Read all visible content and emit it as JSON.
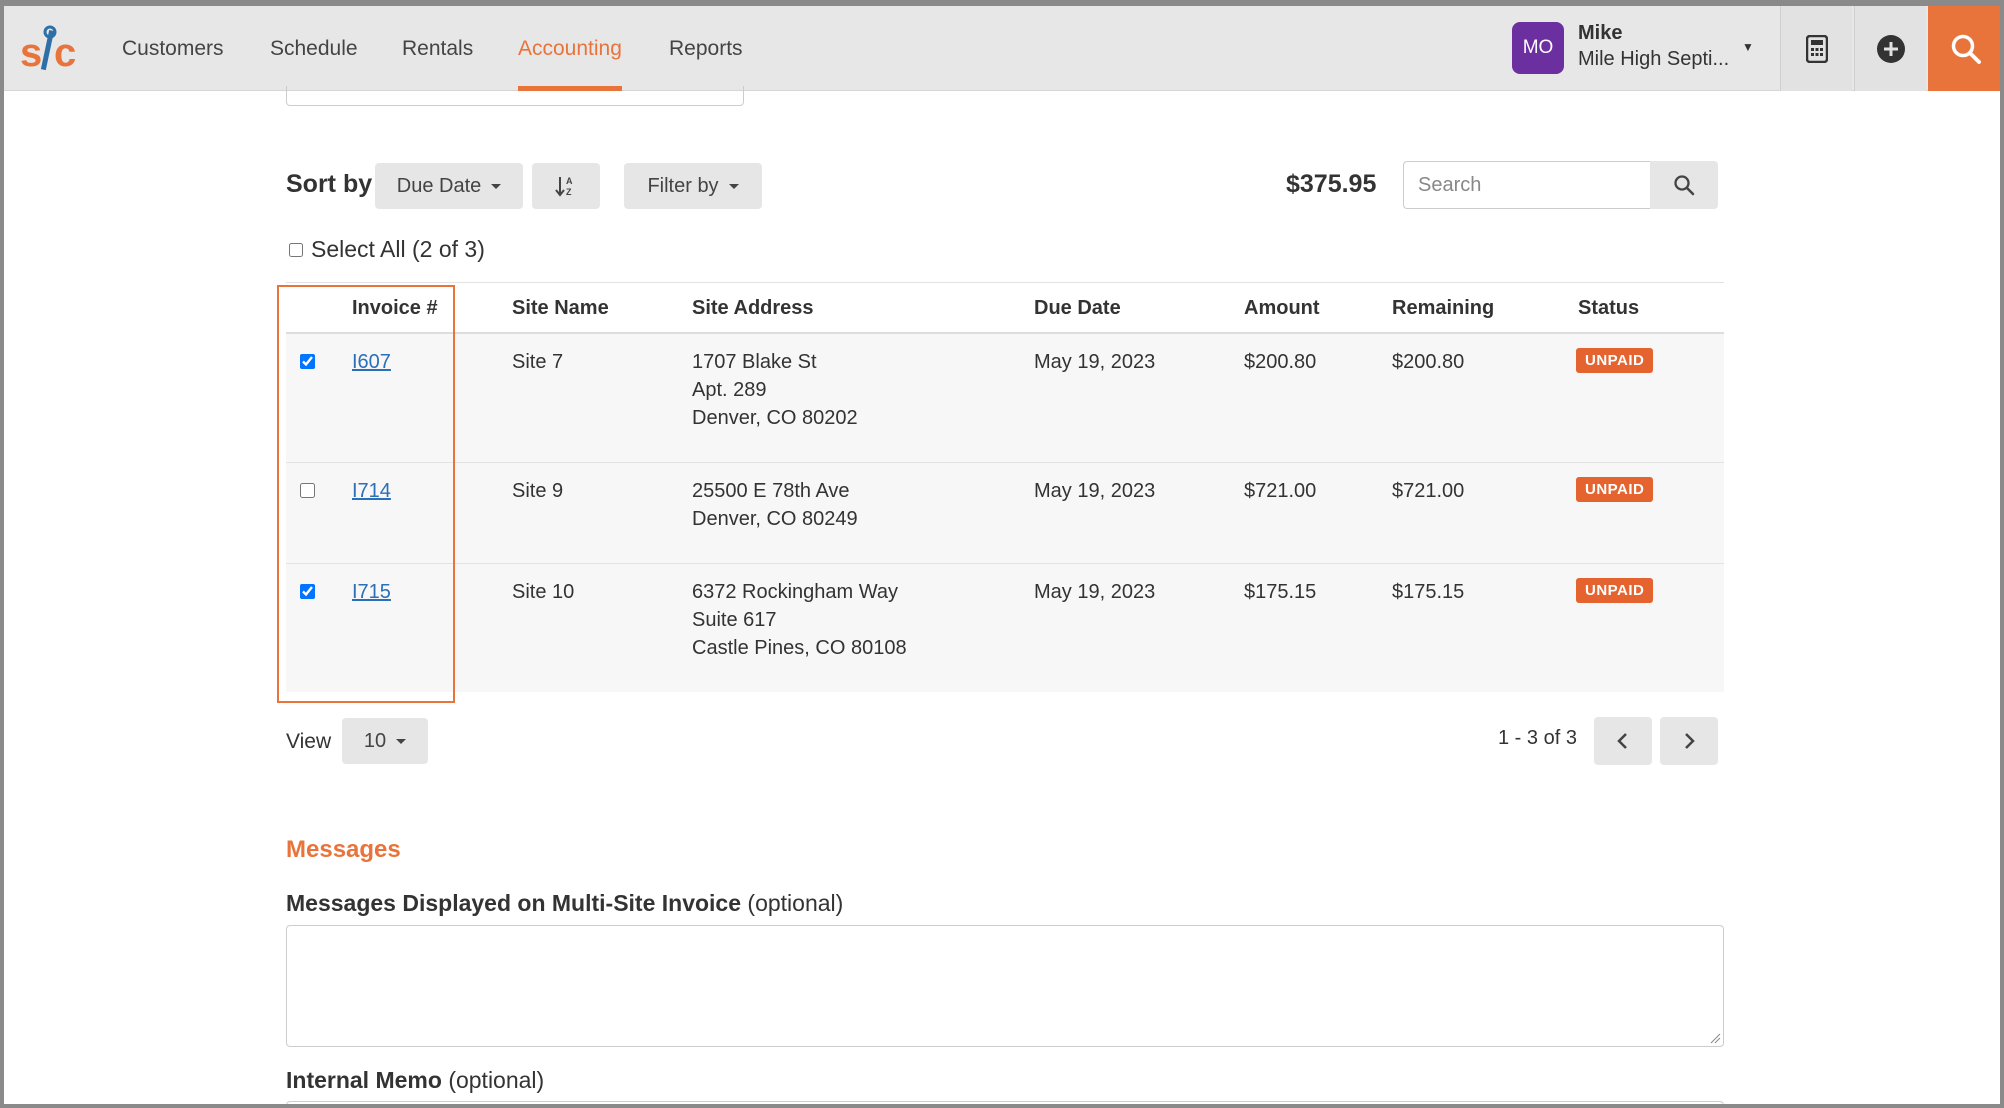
{
  "nav": {
    "items": [
      "Customers",
      "Schedule",
      "Rentals",
      "Accounting",
      "Reports"
    ],
    "active": "Accounting",
    "user": {
      "initials": "MO",
      "name": "Mike",
      "company": "Mile High Septi..."
    }
  },
  "toolbar": {
    "sort_label": "Sort by",
    "sort_value": "Due Date",
    "filter_label": "Filter by",
    "total": "$375.95",
    "search_placeholder": "Search"
  },
  "select_all": "Select All (2 of 3)",
  "table": {
    "headers": [
      "Invoice #",
      "Site Name",
      "Site Address",
      "Due Date",
      "Amount",
      "Remaining",
      "Status"
    ],
    "rows": [
      {
        "checked": true,
        "invoice": "I607",
        "site": "Site 7",
        "address": [
          "1707 Blake St",
          "Apt. 289",
          "Denver, CO 80202"
        ],
        "due": "May 19, 2023",
        "amount": "$200.80",
        "remaining": "$200.80",
        "status": "UNPAID"
      },
      {
        "checked": false,
        "invoice": "I714",
        "site": "Site 9",
        "address": [
          "25500 E 78th Ave",
          "Denver, CO 80249"
        ],
        "due": "May 19, 2023",
        "amount": "$721.00",
        "remaining": "$721.00",
        "status": "UNPAID"
      },
      {
        "checked": true,
        "invoice": "I715",
        "site": "Site 10",
        "address": [
          "6372 Rockingham Way",
          "Suite 617",
          "Castle Pines, CO 80108"
        ],
        "due": "May 19, 2023",
        "amount": "$175.15",
        "remaining": "$175.15",
        "status": "UNPAID"
      }
    ]
  },
  "pagination": {
    "view_label": "View",
    "page_size": "10",
    "info": "1 - 3 of 3"
  },
  "messages": {
    "title": "Messages",
    "multi_label": "Messages Displayed on Multi-Site Invoice",
    "optional": "(optional)",
    "memo_label": "Internal Memo",
    "memo_optional": "(optional)"
  },
  "colors": {
    "accent": "#e8743b",
    "badge": "#e4632e",
    "link": "#2a6fb8",
    "avatar": "#6b2fa0"
  }
}
